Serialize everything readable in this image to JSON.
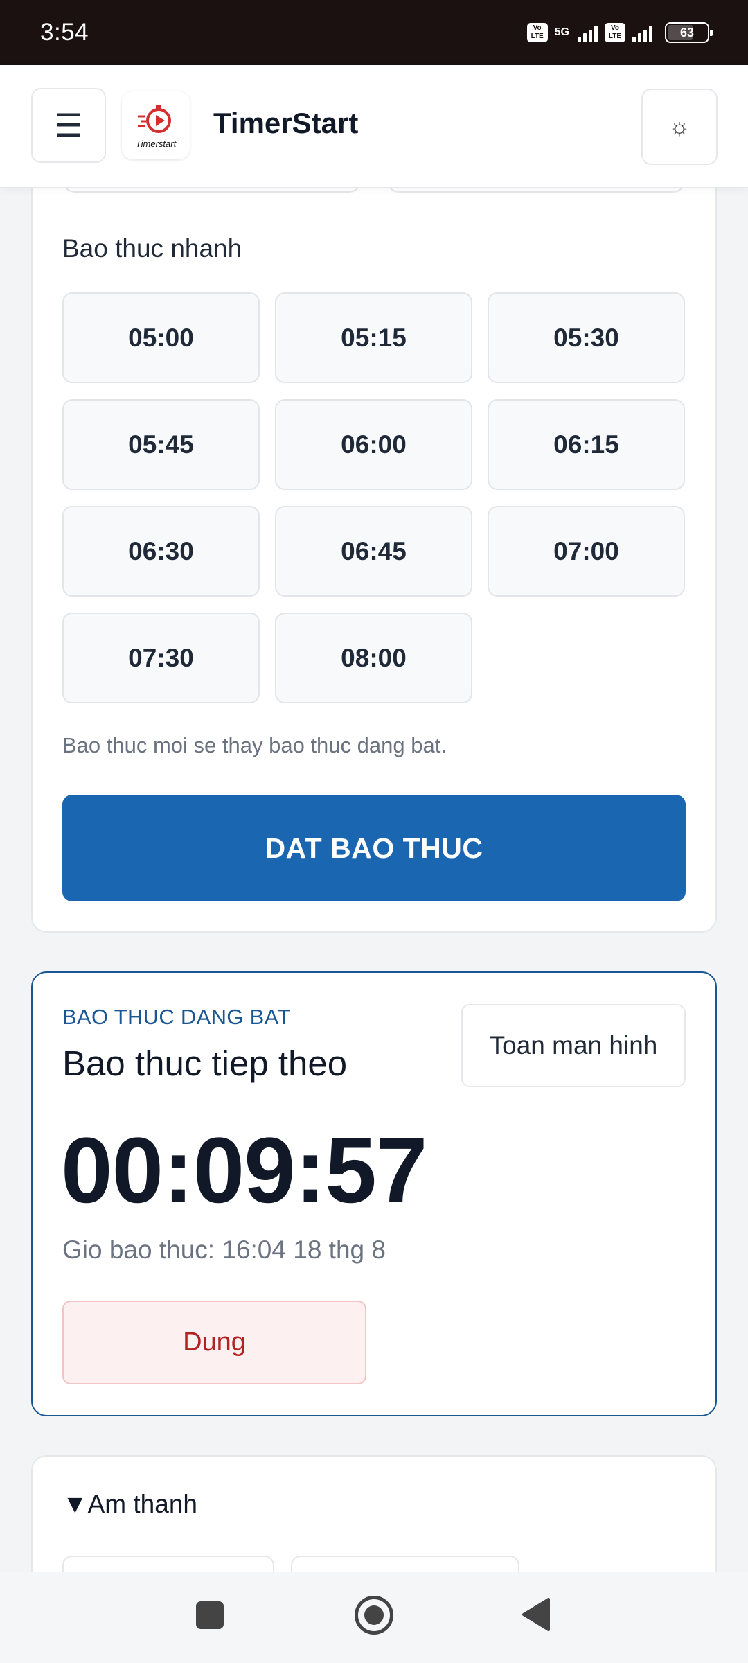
{
  "status_bar": {
    "time": "3:54",
    "network_label": "5G",
    "volte_label": "Vo\nLTE",
    "battery": "63"
  },
  "header": {
    "menu_icon": "☰",
    "logo_caption": "Timerstart",
    "app_title": "TimerStart",
    "theme_icon": "☼"
  },
  "quick_alarm": {
    "title": "Bao thuc nhanh",
    "presets": [
      "05:00",
      "05:15",
      "05:30",
      "05:45",
      "06:00",
      "06:15",
      "06:30",
      "06:45",
      "07:00",
      "07:30",
      "08:00"
    ],
    "note": "Bao thuc moi se thay bao thuc dang bat.",
    "set_button": "DAT BAO THUC"
  },
  "active_alarm": {
    "kicker": "BAO THUC DANG BAT",
    "title": "Bao thuc tiep theo",
    "fullscreen_button": "Toan man hinh",
    "countdown": "00:09:57",
    "alarm_time": "Gio bao thuc: 16:04 18 thg 8",
    "stop_button": "Dung"
  },
  "sound": {
    "summary": "▼Am thanh"
  },
  "colors": {
    "primary": "#1a66b1",
    "active_border": "#1a5693",
    "danger_text": "#b22222",
    "danger_bg": "#fdf0f0"
  }
}
